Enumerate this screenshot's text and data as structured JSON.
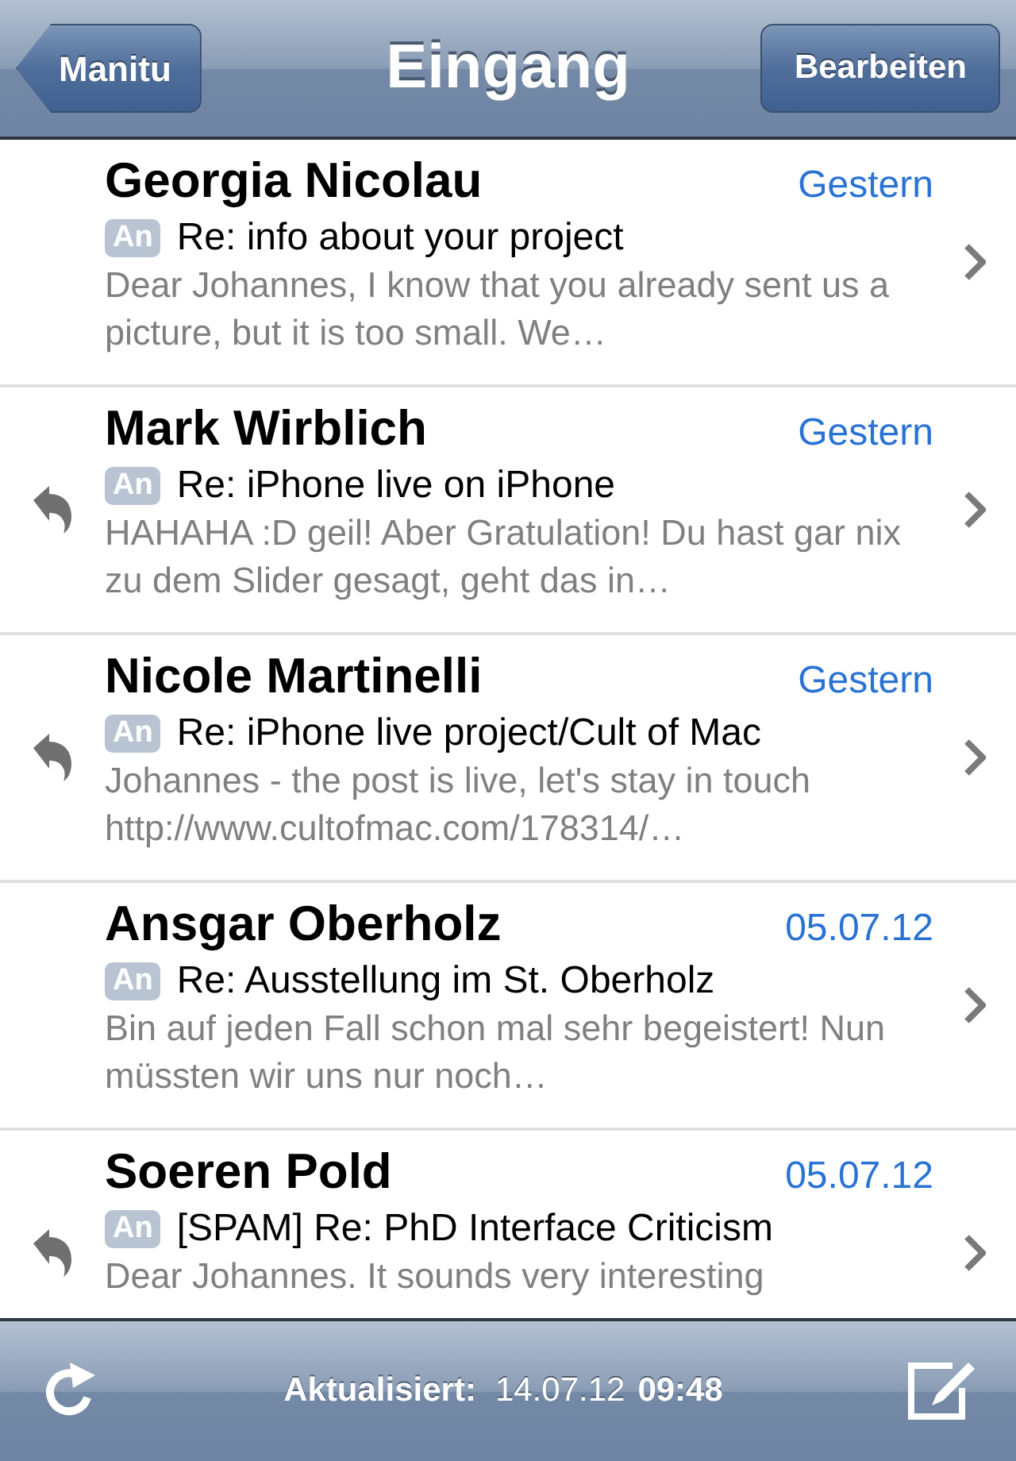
{
  "nav": {
    "back": "Manitu",
    "title": "Eingang",
    "edit": "Bearbeiten"
  },
  "messages": [
    {
      "sender": "Georgia Nicolau",
      "date": "Gestern",
      "tag": "An",
      "subject": "Re: info about your project",
      "preview": "Dear Johannes, I know that you already sent us a picture, but it is too small. We…",
      "replied": false
    },
    {
      "sender": "Mark Wirblich",
      "date": "Gestern",
      "tag": "An",
      "subject": "Re: iPhone live on iPhone",
      "preview": "HAHAHA :D geil! Aber Gratulation! Du hast gar nix zu dem Slider gesagt, geht das in…",
      "replied": true
    },
    {
      "sender": "Nicole Martinelli",
      "date": "Gestern",
      "tag": "An",
      "subject": "Re: iPhone live project/Cult of Mac",
      "preview": "Johannes - the post is live, let's stay in touch http://www.cultofmac.com/178314/…",
      "replied": true
    },
    {
      "sender": "Ansgar Oberholz",
      "date": "05.07.12",
      "tag": "An",
      "subject": "Re: Ausstellung im St. Oberholz",
      "preview": "Bin auf jeden Fall schon mal sehr begeistert! Nun müssten wir uns nur noch…",
      "replied": false
    },
    {
      "sender": "Soeren Pold",
      "date": "05.07.12",
      "tag": "An",
      "subject": "[SPAM] Re: PhD Interface Criticism",
      "preview": "Dear Johannes. It sounds very interesting",
      "replied": true
    }
  ],
  "toolbar": {
    "label": "Aktualisiert:",
    "date": "14.07.12",
    "time": "09:48"
  }
}
